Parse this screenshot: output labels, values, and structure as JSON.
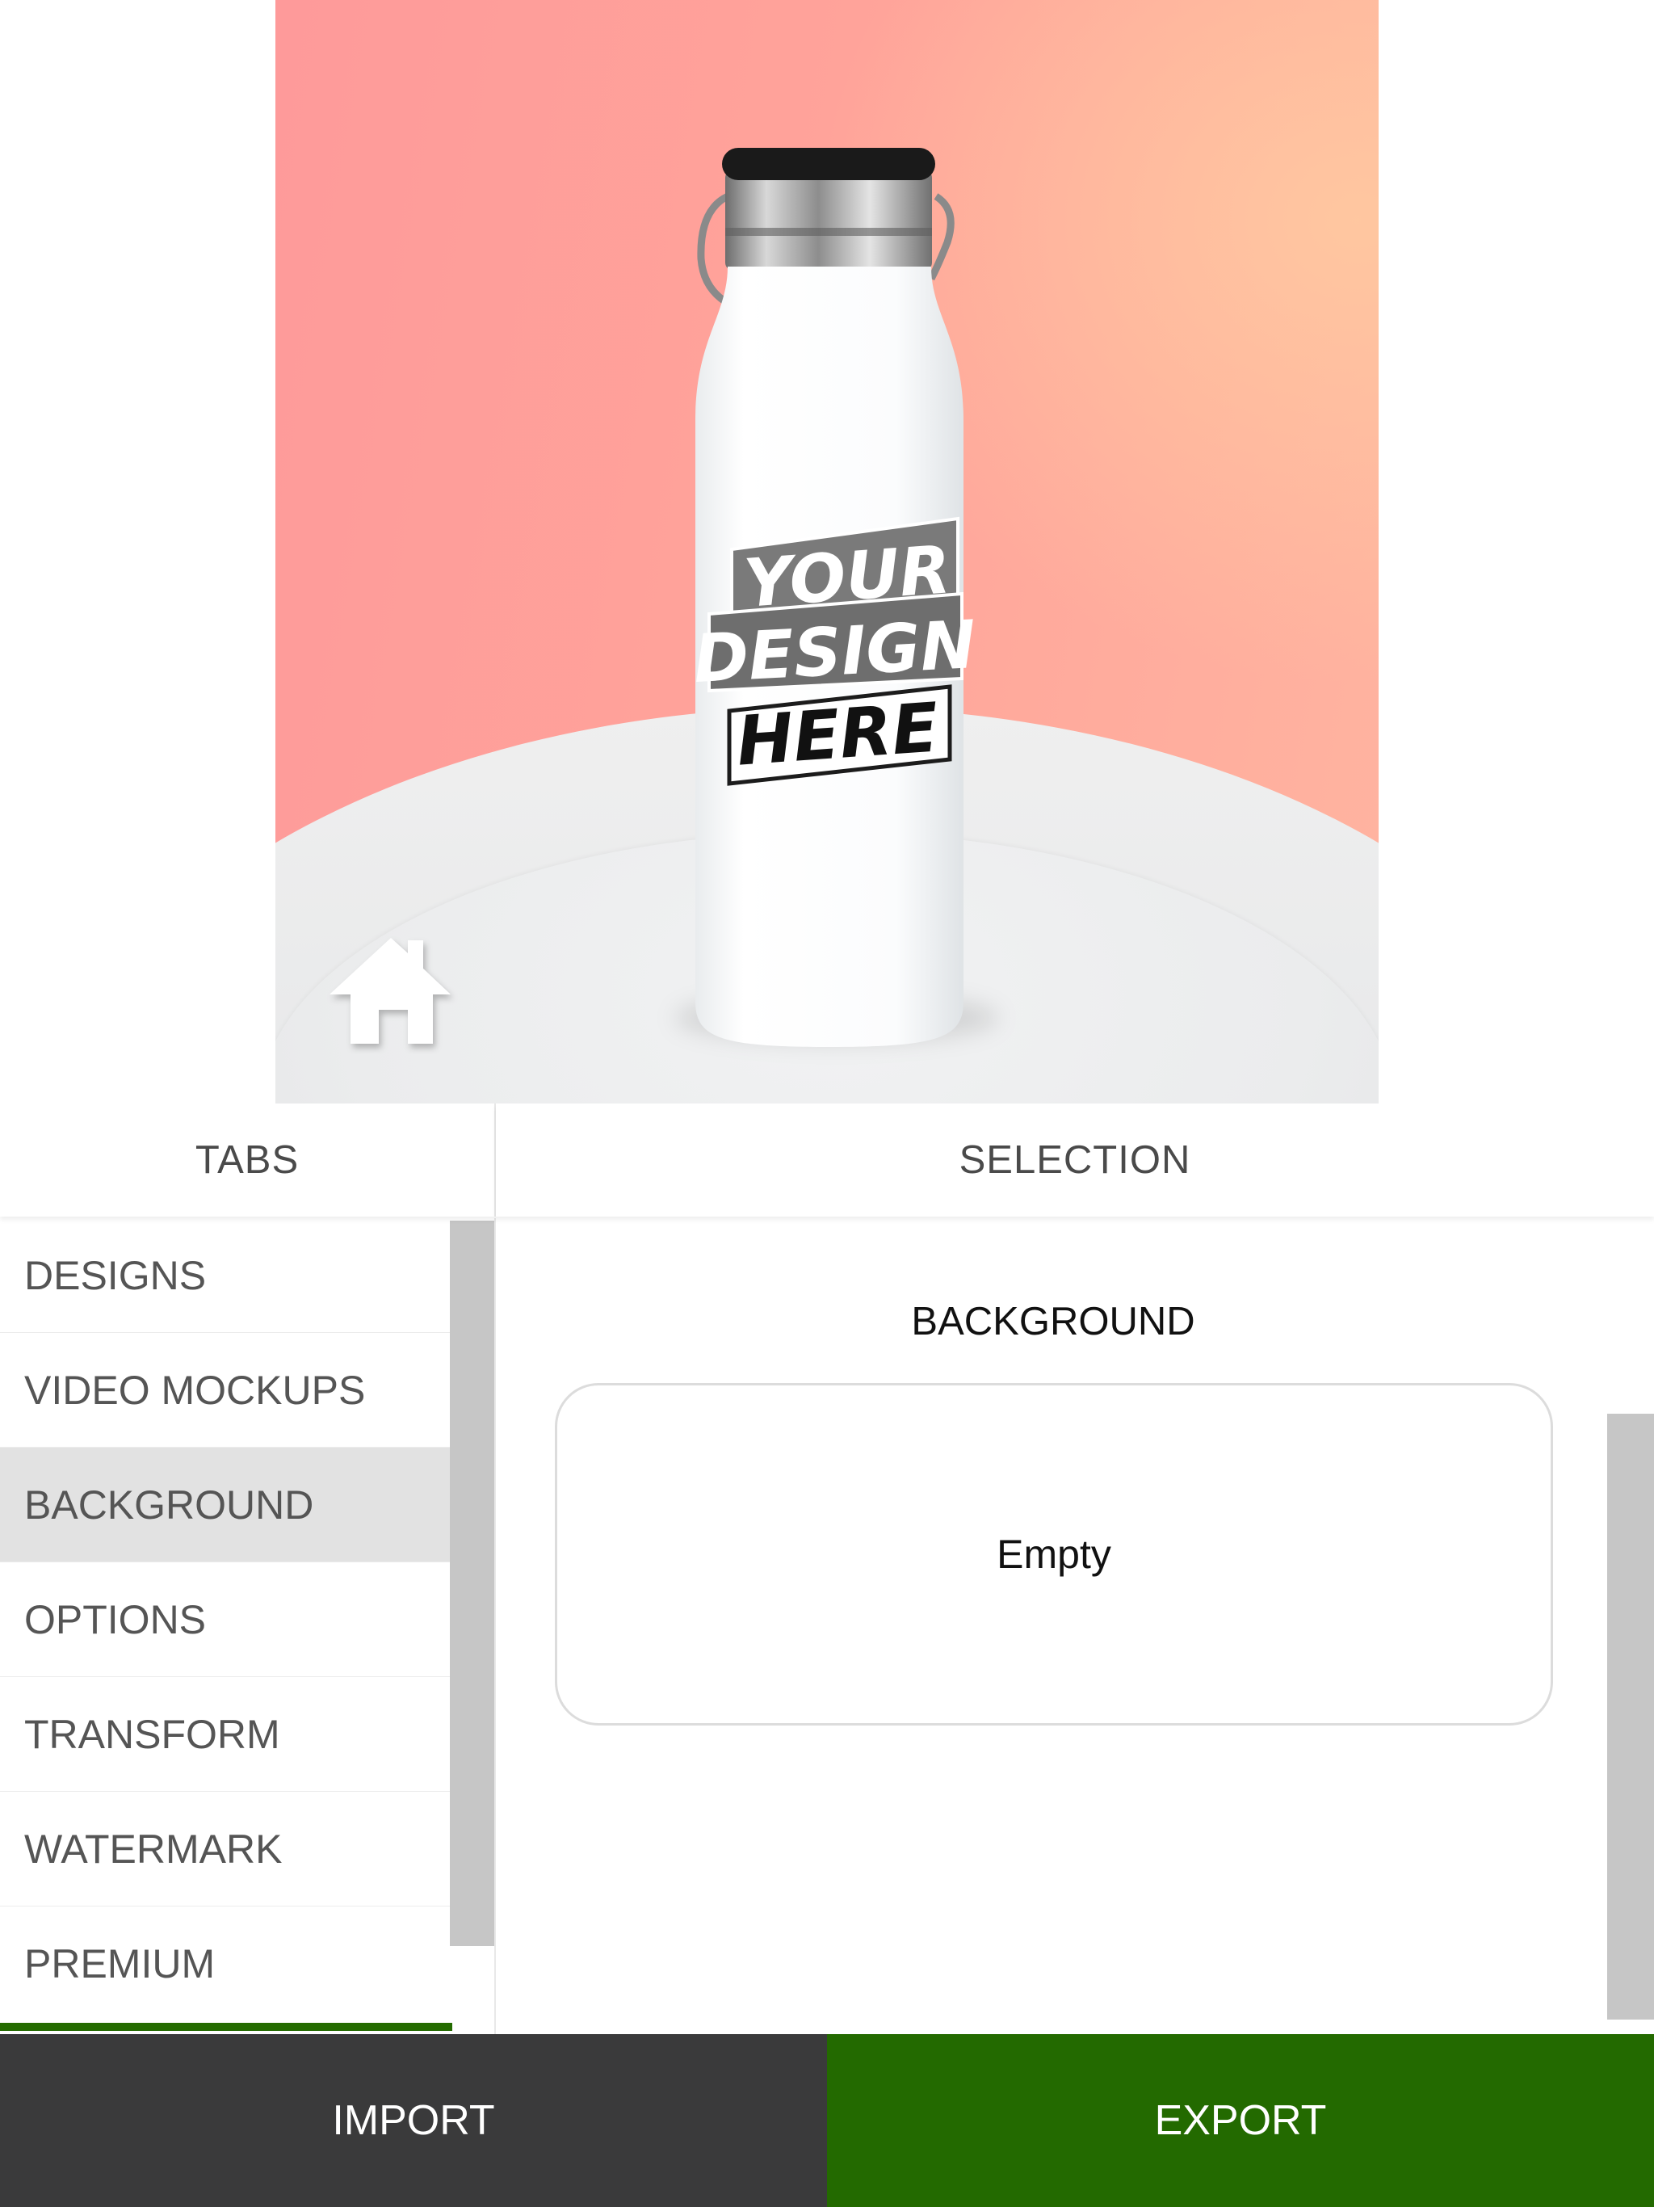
{
  "preview": {
    "design_placeholder": {
      "line1": "YOUR",
      "line2": "DESIGN",
      "line3": "HERE"
    },
    "home_icon": "home-icon"
  },
  "headers": {
    "tabs": "TABS",
    "selection": "SELECTION"
  },
  "tabs": {
    "items": [
      {
        "label": "DESIGNS"
      },
      {
        "label": "VIDEO MOCKUPS"
      },
      {
        "label": "BACKGROUND"
      },
      {
        "label": "OPTIONS"
      },
      {
        "label": "TRANSFORM"
      },
      {
        "label": "WATERMARK"
      },
      {
        "label": "PREMIUM"
      }
    ],
    "active": "BACKGROUND"
  },
  "selection": {
    "title": "BACKGROUND",
    "slot_text": "Empty"
  },
  "actions": {
    "import": "IMPORT",
    "export": "EXPORT"
  },
  "colors": {
    "export_green": "#236a00",
    "import_dark": "#3a3a3b",
    "active_tab": "#e2e2e2",
    "preview_pink": "#fe9a9a"
  }
}
